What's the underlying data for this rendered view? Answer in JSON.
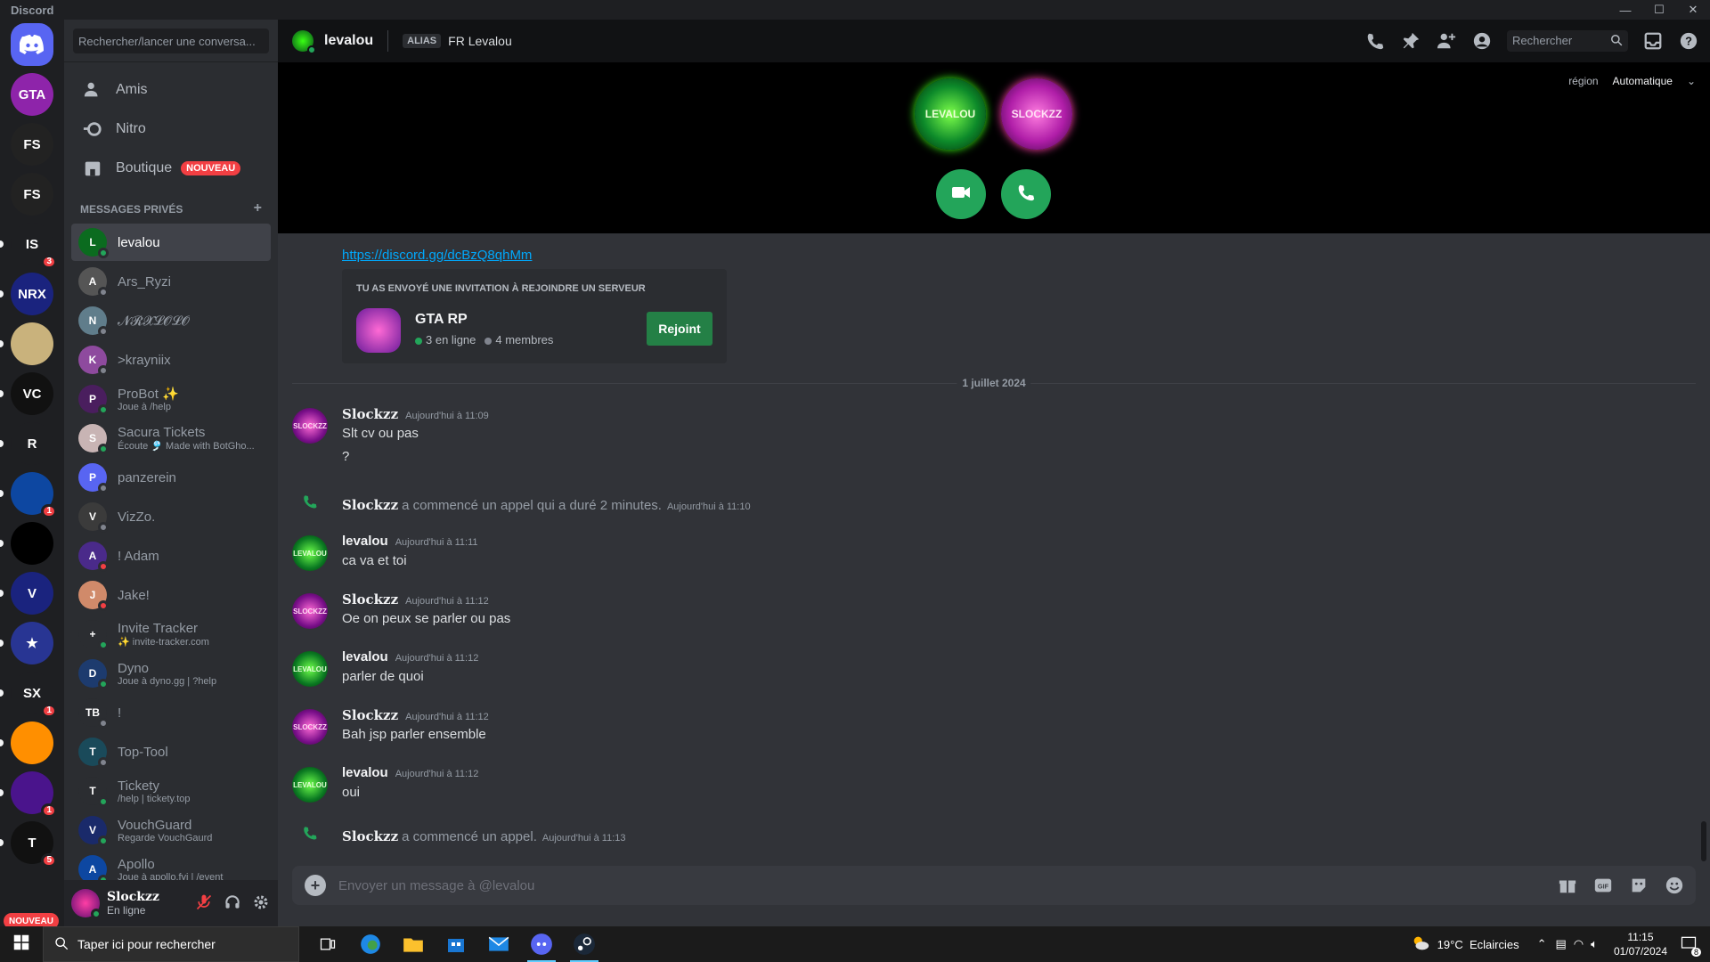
{
  "window": {
    "title": "Discord"
  },
  "servers": {
    "nouveau_label": "NOUVEAU",
    "items": [
      {
        "name": "Discord Home",
        "label": "",
        "color": "#5865f2",
        "badge": ""
      },
      {
        "name": "GTA RP",
        "label": "GTA",
        "color": "#8e24aa",
        "badge": ""
      },
      {
        "name": "Fortnite Swapper 1",
        "label": "FS",
        "color": "#222222",
        "badge": ""
      },
      {
        "name": "Fortnite Swapper 2",
        "label": "FS",
        "color": "#222222",
        "badge": ""
      },
      {
        "name": "IS",
        "label": "IS",
        "color": "#1e1f22",
        "badge": "3"
      },
      {
        "name": "NRX",
        "label": "NRX",
        "color": "#1a237e",
        "badge": ""
      },
      {
        "name": "Desert",
        "label": "",
        "color": "#c9b27c",
        "badge": ""
      },
      {
        "name": "VC",
        "label": "VC",
        "color": "#111111",
        "badge": ""
      },
      {
        "name": "R",
        "label": "R",
        "color": "#1e1f22",
        "badge": ""
      },
      {
        "name": "Bot",
        "label": "",
        "color": "#0d47a1",
        "badge": "1"
      },
      {
        "name": "Globe",
        "label": "",
        "color": "#000000",
        "badge": ""
      },
      {
        "name": "V Shield",
        "label": "V",
        "color": "#1a237e",
        "badge": ""
      },
      {
        "name": "Star",
        "label": "★",
        "color": "#283593",
        "badge": ""
      },
      {
        "name": "SX",
        "label": "SX",
        "color": "#1e1f22",
        "badge": "1"
      },
      {
        "name": "Orange",
        "label": "",
        "color": "#ff8f00",
        "badge": ""
      },
      {
        "name": "Wolf",
        "label": "",
        "color": "#4a148c",
        "badge": "1"
      },
      {
        "name": "T",
        "label": "T",
        "color": "#111111",
        "badge": "5"
      }
    ]
  },
  "sidebar": {
    "search_placeholder": "Rechercher/lancer une conversa...",
    "nav": [
      {
        "label": "Amis"
      },
      {
        "label": "Nitro"
      },
      {
        "label": "Boutique",
        "badge": "NOUVEAU"
      }
    ],
    "dm_header": "MESSAGES PRIVÉS",
    "dm_add": "+",
    "dms": [
      {
        "name": "levalou",
        "sub": "",
        "status": "#23a55a",
        "color": "#0b6b1f",
        "initial": "L"
      },
      {
        "name": "Ars_Ryzi",
        "sub": "",
        "status": "#80848e",
        "color": "#555555",
        "initial": "A"
      },
      {
        "name": "𝓝𝓡𝓧𝓛𝓞𝓛𝓞",
        "sub": "",
        "status": "#80848e",
        "color": "#607d8b",
        "initial": "N"
      },
      {
        "name": ">krayniix",
        "sub": "",
        "status": "#80848e",
        "color": "#8e4a9e",
        "initial": "K"
      },
      {
        "name": "ProBot ✨",
        "sub": "Joue à /help",
        "status": "#23a55a",
        "color": "#4a1e5e",
        "initial": "P"
      },
      {
        "name": "Sacura Tickets",
        "sub": "Écoute 🎐 Made with BotGho...",
        "status": "#23a55a",
        "color": "#c8b4b4",
        "initial": "S"
      },
      {
        "name": "panzerein",
        "sub": "",
        "status": "#80848e",
        "color": "#5865f2",
        "initial": "P"
      },
      {
        "name": "VizZo.",
        "sub": "",
        "status": "#80848e",
        "color": "#3b3b3b",
        "initial": "V"
      },
      {
        "name": "! Adam",
        "sub": "",
        "status": "#f23f43",
        "color": "#4a2a8a",
        "initial": "A"
      },
      {
        "name": "Jake!",
        "sub": "",
        "status": "#f23f43",
        "color": "#d08a6a",
        "initial": "J"
      },
      {
        "name": "Invite Tracker",
        "sub": "✨ invite-tracker.com",
        "status": "#23a55a",
        "color": "#2b2d31",
        "initial": "+"
      },
      {
        "name": "Dyno",
        "sub": "Joue à dyno.gg | ?help",
        "status": "#23a55a",
        "color": "#1d3b6e",
        "initial": "D"
      },
      {
        "name": "!",
        "sub": "",
        "status": "#80848e",
        "color": "#2b2d31",
        "initial": "TB"
      },
      {
        "name": "Top-Tool",
        "sub": "",
        "status": "#80848e",
        "color": "#1a4a5a",
        "initial": "T"
      },
      {
        "name": "Tickety",
        "sub": "/help | tickety.top",
        "status": "#23a55a",
        "color": "#2b2d31",
        "initial": "T"
      },
      {
        "name": "VouchGuard",
        "sub": "Regarde VouchGaurd",
        "status": "#23a55a",
        "color": "#1a2a6a",
        "initial": "V"
      },
      {
        "name": "Apollo",
        "sub": "Joue à apollo.fyi | /event",
        "status": "#23a55a",
        "color": "#0d47a1",
        "initial": "A"
      }
    ]
  },
  "user": {
    "name": "Slockzz",
    "status": "En ligne"
  },
  "header": {
    "channel": "levalou",
    "alias_tag": "ALIAS",
    "alias": "FR Levalou",
    "search_placeholder": "Rechercher",
    "region_label": "région",
    "region_value": "Automatique"
  },
  "call": {
    "avatar1": "LEVALOU",
    "avatar2": "SLOCKZZ"
  },
  "chat": {
    "link": "https://discord.gg/dcBzQ8qhMm",
    "invite": {
      "heading": "TU AS ENVOYÉ UNE INVITATION À REJOINDRE UN SERVEUR",
      "server": "GTA RP",
      "online": "3 en ligne",
      "members": "4 membres",
      "button": "Rejoint"
    },
    "date": "1 juillet 2024",
    "messages": [
      {
        "author": "Slockzz",
        "time": "Aujourd'hui à 11:09",
        "lines": [
          "Slt cv ou pas",
          "?"
        ]
      },
      {
        "author": "levalou",
        "time": "Aujourd'hui à 11:11",
        "lines": [
          "ca va et toi"
        ]
      },
      {
        "author": "Slockzz",
        "time": "Aujourd'hui à 11:12",
        "lines": [
          "Oe on peux se parler ou pas"
        ]
      },
      {
        "author": "levalou",
        "time": "Aujourd'hui à 11:12",
        "lines": [
          "parler de quoi"
        ]
      },
      {
        "author": "Slockzz",
        "time": "Aujourd'hui à 11:12",
        "lines": [
          "Bah jsp parler ensemble"
        ]
      },
      {
        "author": "levalou",
        "time": "Aujourd'hui à 11:12",
        "lines": [
          "oui"
        ]
      }
    ],
    "system": [
      {
        "author": "Slockzz",
        "text": "a commencé un appel qui a duré 2 minutes.",
        "time": "Aujourd'hui à 11:10"
      },
      {
        "author": "Slockzz",
        "text": "a commencé un appel.",
        "time": "Aujourd'hui à 11:13"
      }
    ],
    "composer_placeholder": "Envoyer un message à @levalou"
  },
  "taskbar": {
    "search": "Taper ici pour rechercher",
    "weather": "19°C  Eclaircies",
    "time": "11:15",
    "date": "01/07/2024",
    "notif": "8"
  },
  "colors": {
    "accent": "#5865f2",
    "green": "#23a55a",
    "link": "#00a8fc",
    "slockzz": "#f2f3f5",
    "levalou": "#f2f3f5"
  }
}
